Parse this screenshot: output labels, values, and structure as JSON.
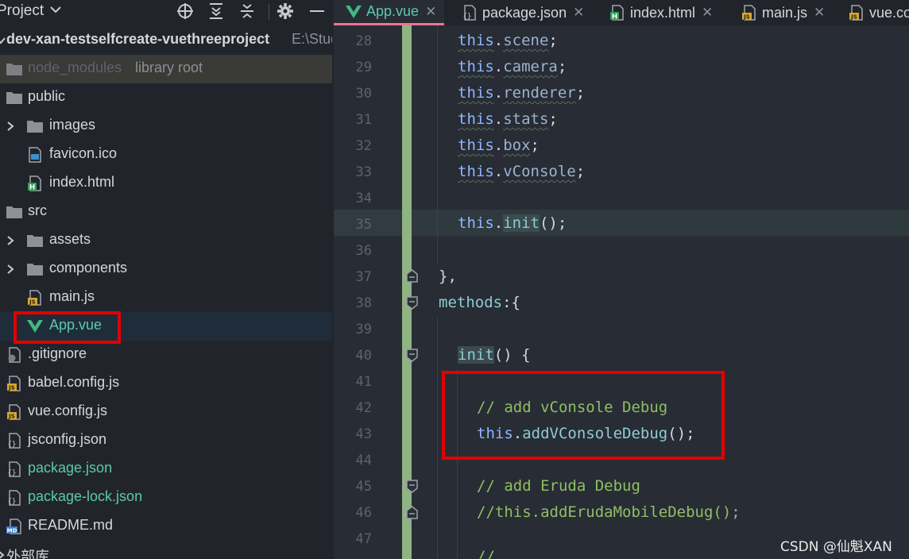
{
  "project_panel": {
    "title": "Project",
    "tree": [
      {
        "name": "dev-xan-testselfcreate-vuethreeproject",
        "hint": "E:\\Stud",
        "icon": "folder-icon"
      },
      {
        "name": "node_modules",
        "hint": "library root",
        "icon": "folder-icon"
      },
      {
        "name": "public",
        "icon": "folder-icon"
      },
      {
        "name": "images",
        "icon": "folder-icon"
      },
      {
        "name": "favicon.ico",
        "icon": "image-file-icon"
      },
      {
        "name": "index.html",
        "icon": "html-file-icon"
      },
      {
        "name": "src",
        "icon": "folder-icon"
      },
      {
        "name": "assets",
        "icon": "folder-icon"
      },
      {
        "name": "components",
        "icon": "folder-icon"
      },
      {
        "name": "main.js",
        "icon": "js-file-icon"
      },
      {
        "name": "App.vue",
        "icon": "vue-file-icon"
      },
      {
        "name": ".gitignore",
        "icon": "gitignore-file-icon"
      },
      {
        "name": "babel.config.js",
        "icon": "js-file-icon"
      },
      {
        "name": "vue.config.js",
        "icon": "js-file-icon"
      },
      {
        "name": "jsconfig.json",
        "icon": "json-file-icon"
      },
      {
        "name": "package.json",
        "icon": "json-file-icon"
      },
      {
        "name": "package-lock.json",
        "icon": "json-file-icon"
      },
      {
        "name": "README.md",
        "icon": "markdown-file-icon"
      },
      {
        "name": "外部库",
        "icon": "library-icon"
      }
    ]
  },
  "tabs": [
    {
      "label": "App.vue",
      "icon": "vue-file-icon",
      "active": true
    },
    {
      "label": "package.json",
      "icon": "json-file-icon"
    },
    {
      "label": "index.html",
      "icon": "html-file-icon"
    },
    {
      "label": "main.js",
      "icon": "js-file-icon"
    },
    {
      "label": "vue.co",
      "icon": "js-file-icon"
    }
  ],
  "line_numbers": [
    "28",
    "29",
    "30",
    "31",
    "32",
    "33",
    "34",
    "35",
    "36",
    "37",
    "38",
    "39",
    "40",
    "41",
    "42",
    "43",
    "44",
    "45",
    "46",
    "47"
  ],
  "code": {
    "l28": {
      "this": "this",
      "dot": ".",
      "prop": "scene",
      "end": ";"
    },
    "l29": {
      "this": "this",
      "dot": ".",
      "prop": "camera",
      "end": ";"
    },
    "l30": {
      "this": "this",
      "dot": ".",
      "prop": "renderer",
      "end": ";"
    },
    "l31": {
      "this": "this",
      "dot": ".",
      "prop": "stats",
      "end": ";"
    },
    "l32": {
      "this": "this",
      "dot": ".",
      "prop": "box",
      "end": ";"
    },
    "l33": {
      "this": "this",
      "dot": ".",
      "prop": "vConsole",
      "end": ";"
    },
    "l35": {
      "this": "this",
      "dot": ".",
      "fn": "init",
      "end": "();"
    },
    "l37": {
      "text": "},"
    },
    "l38": {
      "name": "methods",
      "end": ":{"
    },
    "l40": {
      "fn": "init",
      "end": "() {"
    },
    "l42": {
      "text": "// add vConsole Debug"
    },
    "l43": {
      "this": "this",
      "dot": ".",
      "fn": "addVConsoleDebug",
      "end": "();"
    },
    "l45": {
      "text": "// add Eruda Debug"
    },
    "l46": {
      "text": "//this.addErudaMobileDebug();"
    },
    "l47": {
      "text": "//"
    }
  },
  "watermark": "CSDN @仙魁XAN",
  "colors": {
    "highlight_box": "#e30000",
    "active_tab_underline": "#ff6e96",
    "change_bar": "#8fb383"
  }
}
